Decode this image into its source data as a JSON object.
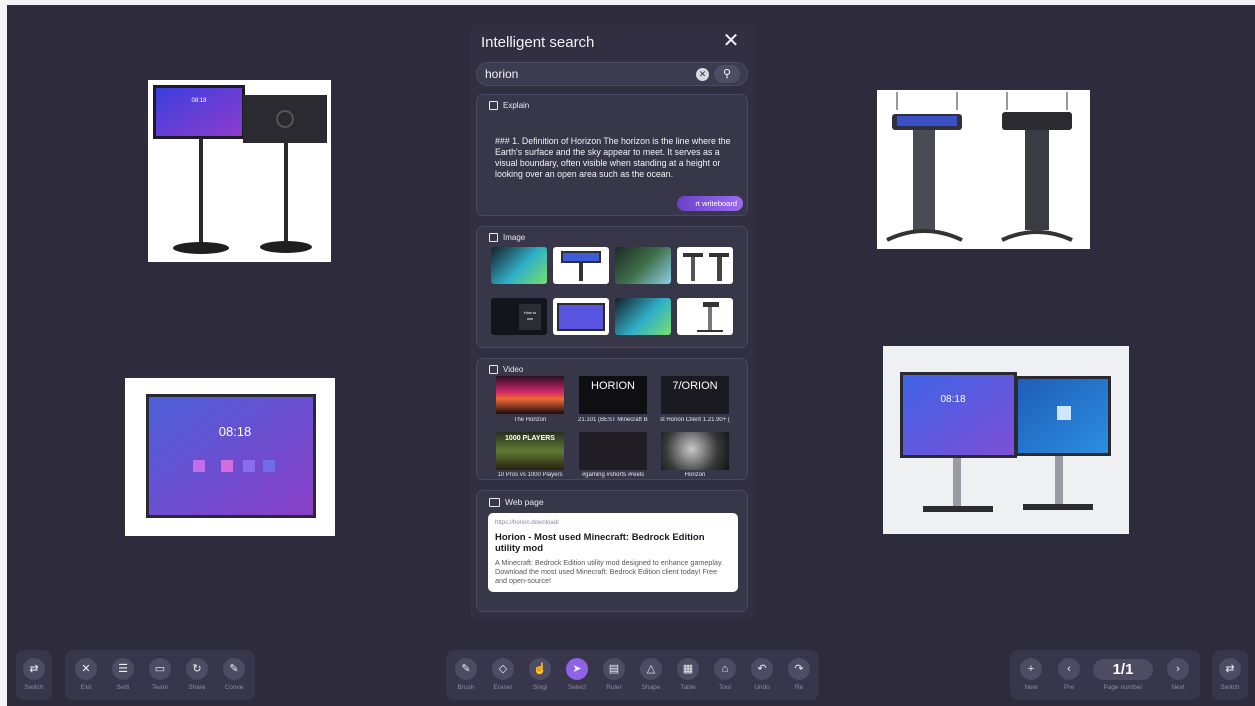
{
  "panel": {
    "title": "Intelligent search",
    "close_icon": "close-icon",
    "search": {
      "value": "horion",
      "clear_icon": "clear-icon",
      "search_icon": "search-icon"
    }
  },
  "explain": {
    "header": "Explain",
    "text": "### 1. Definition of Horizon The horizon is the line where the Earth's surface and the sky appear to meet. It serves as a visual boundary, often visible when standing at a height or looking over an open area such as the ocean.",
    "insert_button": "rt writeboard"
  },
  "image_section": {
    "header": "Image"
  },
  "video_section": {
    "header": "Video",
    "items": [
      {
        "caption": "The Horizon",
        "thumb_text": ""
      },
      {
        "caption": "21.101 (BEST Minecraft Be",
        "thumb_text": "HORION"
      },
      {
        "caption": "st Horion Client 1.21.90+ (",
        "thumb_text": "7/ORION"
      },
      {
        "caption": "10 Pros vs 1000 Players",
        "thumb_text": "1000 PLAYERS"
      },
      {
        "caption": "#gaming #shorts #reels",
        "thumb_text": ""
      },
      {
        "caption": "Horizon",
        "thumb_text": ""
      }
    ]
  },
  "web_section": {
    "header": "Web page",
    "url": "https://horion.download/",
    "title": "Horion - Most used Minecraft: Bedrock Edition utility mod",
    "description": "A Minecraft: Bedrock Edition utility mod designed to enhance gameplay. Download the most used Minecraft: Bedrock Edition client today! Free and open-source!"
  },
  "canvas": {
    "screen_time": "08:18"
  },
  "toolbar_left": {
    "switch": "Switch",
    "items": [
      "Exit",
      "Setti",
      "Team",
      "Share",
      "Conve"
    ]
  },
  "toolbar_center": {
    "items": [
      "Brush",
      "Eraser",
      "Singl",
      "Select",
      "Ruler",
      "Shape",
      "Table",
      "Tool",
      "Undo",
      "Re"
    ]
  },
  "toolbar_right": {
    "new": "New",
    "prev": "Pre",
    "page_number": "1/1",
    "page_label": "Page number",
    "next": "Next",
    "switch": "Switch"
  },
  "colors": {
    "accent": "#8e63e8",
    "background": "#2d2b3c",
    "panel": "#312f41"
  }
}
